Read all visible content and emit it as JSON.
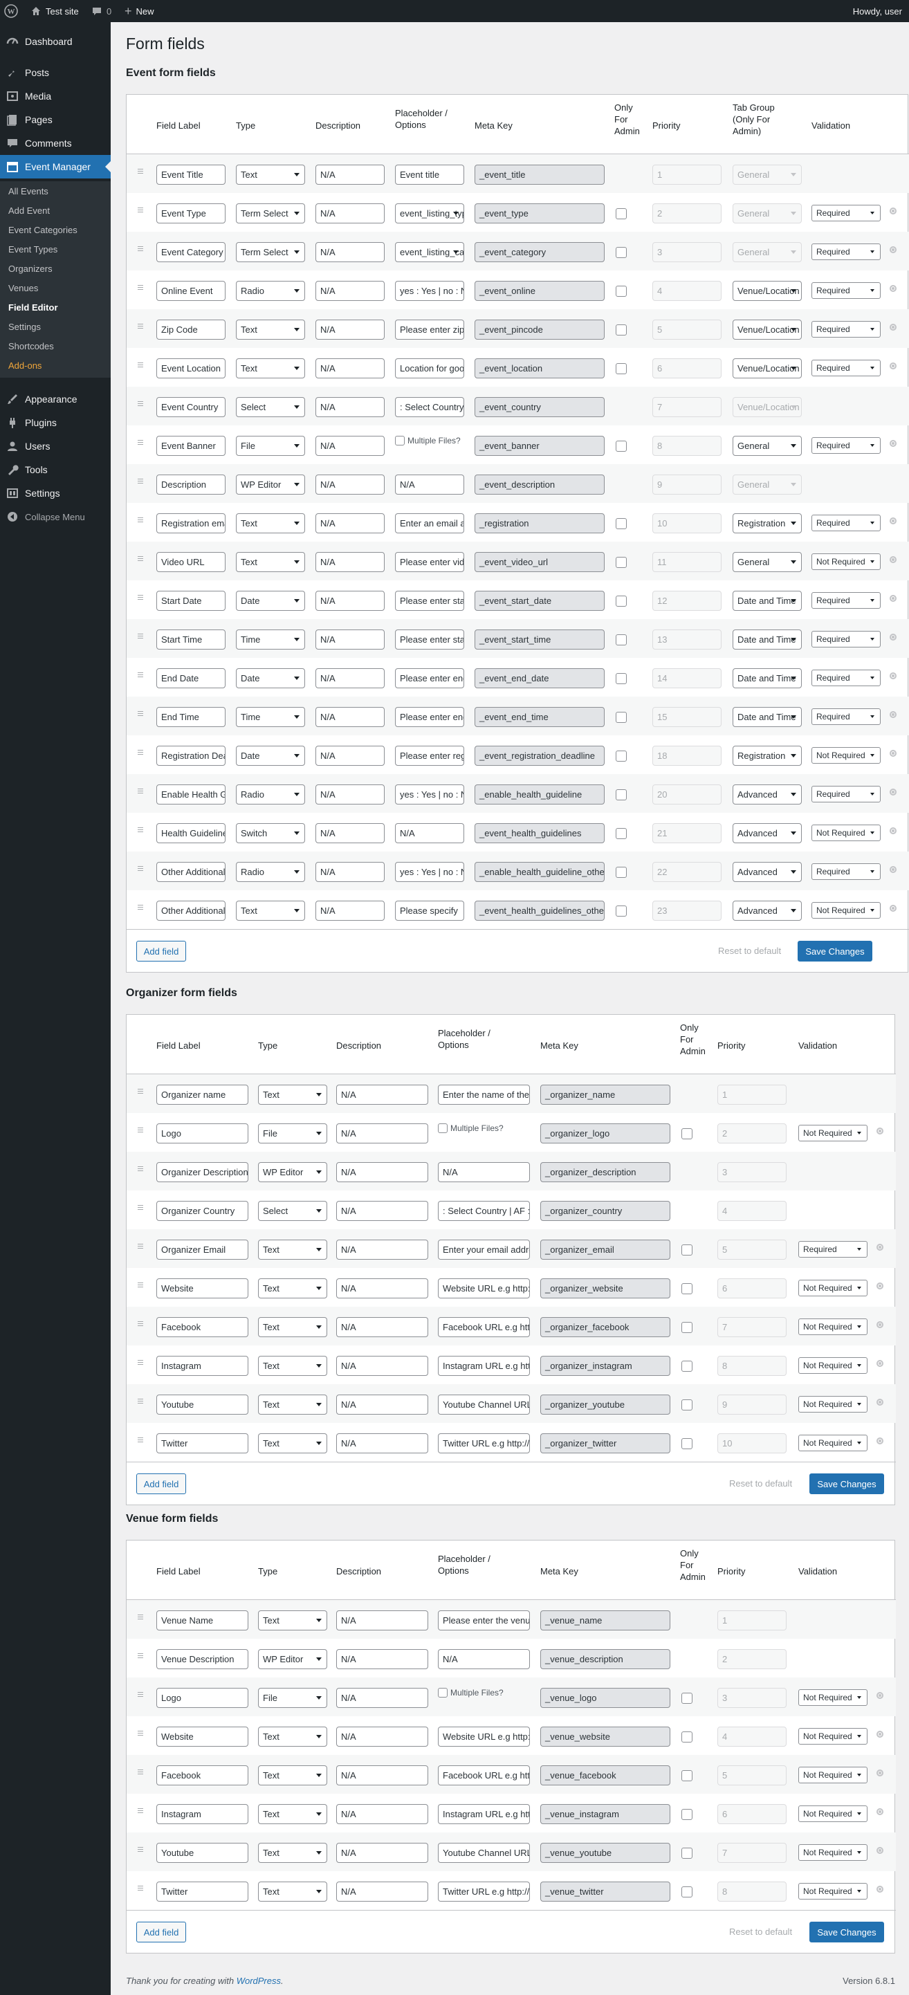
{
  "adminbar": {
    "site": "Test site",
    "comments": "0",
    "new": "New",
    "howdy": "Howdy, user"
  },
  "menu": {
    "dashboard": "Dashboard",
    "posts": "Posts",
    "media": "Media",
    "pages": "Pages",
    "comments": "Comments",
    "event_manager": "Event Manager",
    "appearance": "Appearance",
    "plugins": "Plugins",
    "users": "Users",
    "tools": "Tools",
    "settings": "Settings",
    "collapse": "Collapse Menu",
    "submenu": [
      "All Events",
      "Add Event",
      "Event Categories",
      "Event Types",
      "Organizers",
      "Venues",
      "Field Editor",
      "Settings",
      "Shortcodes",
      "Add-ons"
    ]
  },
  "page_title": "Form fields",
  "event": {
    "title": "Event form fields",
    "headers": {
      "label": "Field Label",
      "type": "Type",
      "description": "Description",
      "placeholder": "Placeholder / Options",
      "meta": "Meta Key",
      "admin": "Only For Admin",
      "priority": "Priority",
      "tab": "Tab Group (Only For Admin)",
      "validation": "Validation"
    },
    "rows": [
      {
        "label": "Event Title",
        "type": "Text",
        "desc": "N/A",
        "ph": "Event title",
        "meta": "_event_title",
        "chk": false,
        "priority": "1",
        "tab": "General",
        "tabdis": true,
        "val": "",
        "gear": false
      },
      {
        "label": "Event Type",
        "type": "Term Select",
        "desc": "N/A",
        "ph": "event_listing_type",
        "phsel": true,
        "meta": "_event_type",
        "chk": true,
        "priority": "2",
        "tab": "General",
        "tabdis": true,
        "val": "Required",
        "gear": true
      },
      {
        "label": "Event Category",
        "type": "Term Select",
        "desc": "N/A",
        "ph": "event_listing_category",
        "phsel": true,
        "meta": "_event_category",
        "chk": true,
        "priority": "3",
        "tab": "General",
        "tabdis": true,
        "val": "Required",
        "gear": true
      },
      {
        "label": "Online Event",
        "type": "Radio",
        "desc": "N/A",
        "ph": "yes : Yes | no : No",
        "meta": "_event_online",
        "chk": true,
        "priority": "4",
        "tab": "Venue/Location",
        "tabdis": false,
        "val": "Required",
        "gear": true
      },
      {
        "label": "Zip Code",
        "type": "Text",
        "desc": "N/A",
        "ph": "Please enter zipcode",
        "meta": "_event_pincode",
        "chk": true,
        "priority": "5",
        "tab": "Venue/Location",
        "tabdis": false,
        "val": "Required",
        "gear": true
      },
      {
        "label": "Event Location",
        "type": "Text",
        "desc": "N/A",
        "ph": "Location for google map",
        "meta": "_event_location",
        "chk": true,
        "priority": "6",
        "tab": "Venue/Location",
        "tabdis": false,
        "val": "Required",
        "gear": true
      },
      {
        "label": "Event Country",
        "type": "Select",
        "desc": "N/A",
        "ph": ": Select Country",
        "meta": "_event_country",
        "chk": false,
        "priority": "7",
        "tab": "Venue/Location",
        "tabdis": true,
        "val": "",
        "gear": false
      },
      {
        "label": "Event Banner",
        "type": "File",
        "desc": "N/A",
        "multi": "Multiple Files?",
        "meta": "_event_banner",
        "chk": true,
        "priority": "8",
        "tab": "General",
        "tabdis": false,
        "val": "Required",
        "gear": true
      },
      {
        "label": "Description",
        "type": "WP Editor",
        "desc": "N/A",
        "ph": "N/A",
        "meta": "_event_description",
        "chk": false,
        "priority": "9",
        "tab": "General",
        "tabdis": true,
        "val": "",
        "gear": false
      },
      {
        "label": "Registration email",
        "type": "Text",
        "desc": "N/A",
        "ph": "Enter an email address",
        "meta": "_registration",
        "chk": true,
        "priority": "10",
        "tab": "Registration",
        "tabdis": false,
        "val": "Required",
        "gear": true
      },
      {
        "label": "Video URL",
        "type": "Text",
        "desc": "N/A",
        "ph": "Please enter video url",
        "meta": "_event_video_url",
        "chk": true,
        "priority": "11",
        "tab": "General",
        "tabdis": false,
        "val": "Not Required",
        "gear": true
      },
      {
        "label": "Start Date",
        "type": "Date",
        "desc": "N/A",
        "ph": "Please enter start date",
        "meta": "_event_start_date",
        "chk": true,
        "priority": "12",
        "tab": "Date and Time",
        "tabdis": false,
        "val": "Required",
        "gear": true
      },
      {
        "label": "Start Time",
        "type": "Time",
        "desc": "N/A",
        "ph": "Please enter start time",
        "meta": "_event_start_time",
        "chk": true,
        "priority": "13",
        "tab": "Date and Time",
        "tabdis": false,
        "val": "Required",
        "gear": true
      },
      {
        "label": "End Date",
        "type": "Date",
        "desc": "N/A",
        "ph": "Please enter end date",
        "meta": "_event_end_date",
        "chk": true,
        "priority": "14",
        "tab": "Date and Time",
        "tabdis": false,
        "val": "Required",
        "gear": true
      },
      {
        "label": "End Time",
        "type": "Time",
        "desc": "N/A",
        "ph": "Please enter end time",
        "meta": "_event_end_time",
        "chk": true,
        "priority": "15",
        "tab": "Date and Time",
        "tabdis": false,
        "val": "Required",
        "gear": true
      },
      {
        "label": "Registration Deadline",
        "type": "Date",
        "desc": "N/A",
        "ph": "Please enter registration deadline",
        "meta": "_event_registration_deadline",
        "chk": true,
        "priority": "18",
        "tab": "Registration",
        "tabdis": false,
        "val": "Not Required",
        "gear": true
      },
      {
        "label": "Enable Health Guideline",
        "type": "Radio",
        "desc": "N/A",
        "ph": "yes : Yes | no : No",
        "meta": "_enable_health_guideline",
        "chk": true,
        "priority": "20",
        "tab": "Advanced",
        "tabdis": false,
        "val": "Required",
        "gear": true
      },
      {
        "label": "Health Guidelines",
        "type": "Switch",
        "desc": "N/A",
        "ph": "N/A",
        "meta": "_event_health_guidelines",
        "chk": true,
        "priority": "21",
        "tab": "Advanced",
        "tabdis": false,
        "val": "Not Required",
        "gear": true
      },
      {
        "label": "Other Additional",
        "type": "Radio",
        "desc": "N/A",
        "ph": "yes : Yes | no : No",
        "meta": "_enable_health_guideline_other",
        "chk": true,
        "priority": "22",
        "tab": "Advanced",
        "tabdis": false,
        "val": "Required",
        "gear": true
      },
      {
        "label": "Other Additional",
        "type": "Text",
        "desc": "N/A",
        "ph": "Please specify",
        "meta": "_event_health_guidelines_other",
        "chk": true,
        "priority": "23",
        "tab": "Advanced",
        "tabdis": false,
        "val": "Not Required",
        "gear": true
      }
    ]
  },
  "organizer": {
    "title": "Organizer form fields",
    "headers": {
      "label": "Field Label",
      "type": "Type",
      "description": "Description",
      "placeholder": "Placeholder / Options",
      "meta": "Meta Key",
      "admin": "Only For Admin",
      "priority": "Priority",
      "validation": "Validation"
    },
    "rows": [
      {
        "label": "Organizer name",
        "type": "Text",
        "desc": "N/A",
        "ph": "Enter the name of the organization",
        "meta": "_organizer_name",
        "chk": false,
        "priority": "1",
        "val": "",
        "gear": false
      },
      {
        "label": "Logo",
        "type": "File",
        "desc": "N/A",
        "multi": "Multiple Files?",
        "meta": "_organizer_logo",
        "chk": true,
        "priority": "2",
        "val": "Not Required",
        "gear": true
      },
      {
        "label": "Organizer Description",
        "type": "WP Editor",
        "desc": "N/A",
        "ph": "N/A",
        "meta": "_organizer_description",
        "chk": false,
        "priority": "3",
        "val": "",
        "gear": false
      },
      {
        "label": "Organizer Country",
        "type": "Select",
        "desc": "N/A",
        "ph": ": Select Country | AF : Afghanistan",
        "meta": "_organizer_country",
        "chk": false,
        "priority": "4",
        "val": "",
        "gear": false
      },
      {
        "label": "Organizer Email",
        "type": "Text",
        "desc": "N/A",
        "ph": "Enter your email address",
        "meta": "_organizer_email",
        "chk": true,
        "priority": "5",
        "val": "Required",
        "gear": true
      },
      {
        "label": "Website",
        "type": "Text",
        "desc": "N/A",
        "ph": "Website URL e.g http://www.yourorganization.com",
        "meta": "_organizer_website",
        "chk": true,
        "priority": "6",
        "val": "Not Required",
        "gear": true
      },
      {
        "label": "Facebook",
        "type": "Text",
        "desc": "N/A",
        "ph": "Facebook URL e.g http://www.facebook.com/yourorganizer",
        "meta": "_organizer_facebook",
        "chk": true,
        "priority": "7",
        "val": "Not Required",
        "gear": true
      },
      {
        "label": "Instagram",
        "type": "Text",
        "desc": "N/A",
        "ph": "Instagram URL e.g http://www.instagram.com/yourorganizer",
        "meta": "_organizer_instagram",
        "chk": true,
        "priority": "8",
        "val": "Not Required",
        "gear": true
      },
      {
        "label": "Youtube",
        "type": "Text",
        "desc": "N/A",
        "ph": "Youtube Channel URL e.g http://www.youtube.com/channel/yourorganizer",
        "meta": "_organizer_youtube",
        "chk": true,
        "priority": "9",
        "val": "Not Required",
        "gear": true
      },
      {
        "label": "Twitter",
        "type": "Text",
        "desc": "N/A",
        "ph": "Twitter URL e.g http://twitter.com/yourorganizer",
        "meta": "_organizer_twitter",
        "chk": true,
        "priority": "10",
        "val": "Not Required",
        "gear": true
      }
    ]
  },
  "venue": {
    "title": "Venue form fields",
    "headers": {
      "label": "Field Label",
      "type": "Type",
      "description": "Description",
      "placeholder": "Placeholder / Options",
      "meta": "Meta Key",
      "admin": "Only For Admin",
      "priority": "Priority",
      "validation": "Validation"
    },
    "rows": [
      {
        "label": "Venue Name",
        "type": "Text",
        "desc": "N/A",
        "ph": "Please enter the venue name",
        "meta": "_venue_name",
        "chk": false,
        "priority": "1",
        "val": "",
        "gear": false
      },
      {
        "label": "Venue Description",
        "type": "WP Editor",
        "desc": "N/A",
        "ph": "N/A",
        "meta": "_venue_description",
        "chk": false,
        "priority": "2",
        "val": "",
        "gear": false
      },
      {
        "label": "Logo",
        "type": "File",
        "desc": "N/A",
        "multi": "Multiple Files?",
        "meta": "_venue_logo",
        "chk": true,
        "priority": "3",
        "val": "Not Required",
        "gear": true
      },
      {
        "label": "Website",
        "type": "Text",
        "desc": "N/A",
        "ph": "Website URL e.g http://www.yourvenue.com",
        "meta": "_venue_website",
        "chk": true,
        "priority": "4",
        "val": "Not Required",
        "gear": true
      },
      {
        "label": "Facebook",
        "type": "Text",
        "desc": "N/A",
        "ph": "Facebook URL e.g http://www.facebook.com/yourvenue",
        "meta": "_venue_facebook",
        "chk": true,
        "priority": "5",
        "val": "Not Required",
        "gear": true
      },
      {
        "label": "Instagram",
        "type": "Text",
        "desc": "N/A",
        "ph": "Instagram URL e.g http://www.instagram.com/yourvenue",
        "meta": "_venue_instagram",
        "chk": true,
        "priority": "6",
        "val": "Not Required",
        "gear": true
      },
      {
        "label": "Youtube",
        "type": "Text",
        "desc": "N/A",
        "ph": "Youtube Channel URL e.g http://www.youtube.com/channel/yourvenue",
        "meta": "_venue_youtube",
        "chk": true,
        "priority": "7",
        "val": "Not Required",
        "gear": true
      },
      {
        "label": "Twitter",
        "type": "Text",
        "desc": "N/A",
        "ph": "Twitter URL e.g http://twitter.com/yourvenue",
        "meta": "_venue_twitter",
        "chk": true,
        "priority": "8",
        "val": "Not Required",
        "gear": true
      }
    ]
  },
  "buttons": {
    "add": "Add field",
    "reset": "Reset to default",
    "save": "Save Changes"
  },
  "footer": {
    "text": "Thank you for creating with ",
    "link": "WordPress",
    "end": ".",
    "version": "Version 6.8.1"
  }
}
